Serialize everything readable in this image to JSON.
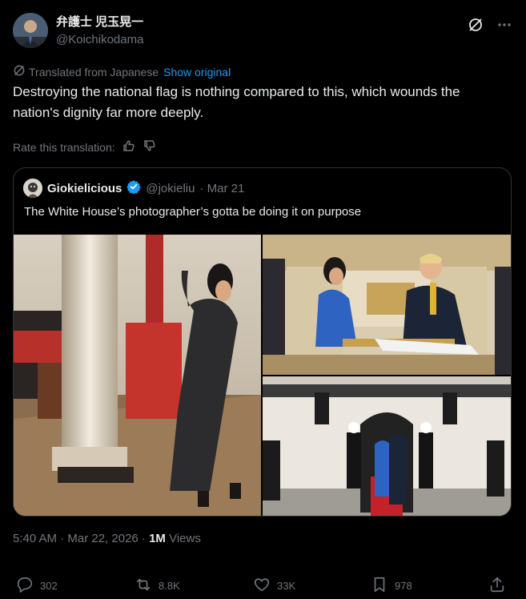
{
  "author": {
    "name": "弁護士 児玉晃一",
    "handle": "@Koichikodama"
  },
  "translation": {
    "label": "Translated from Japanese",
    "show_original": "Show original"
  },
  "tweet": {
    "text": "Destroying the national flag is nothing compared to this, which wounds the nation's dignity far more deeply."
  },
  "rate": {
    "label": "Rate this translation:"
  },
  "quote": {
    "name": "Giokielicious",
    "handle": "@jokieliu",
    "date": "· Mar 21",
    "text": "The White House’s photographer’s gotta be doing it on purpose"
  },
  "meta": {
    "time": "5:40 AM · Mar 22, 2026 · ",
    "views_count": "1M",
    "views_label": " Views"
  },
  "actions": {
    "replies": "302",
    "reposts": "8.8K",
    "likes": "33K",
    "bookmarks": "978"
  }
}
